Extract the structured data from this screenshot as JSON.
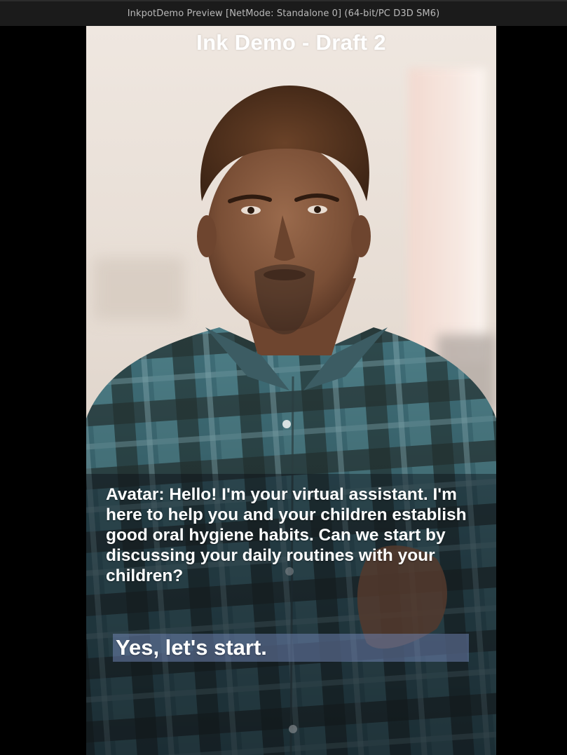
{
  "window": {
    "title": "InkpotDemo Preview [NetMode: Standalone 0]  (64-bit/PC D3D SM6)"
  },
  "game": {
    "title": "Ink Demo - Draft 2",
    "dialogue": "Avatar: Hello! I'm your virtual assistant. I'm here to help you and your children establish good oral hygiene habits. Can we start by discussing your daily routines with your children?",
    "choices": [
      {
        "label": "Yes, let's start."
      }
    ]
  },
  "colors": {
    "titlebar": "#1b1b1b",
    "letterbox": "#000000",
    "choice_highlight": "#6e82af",
    "text": "#ffffff"
  }
}
